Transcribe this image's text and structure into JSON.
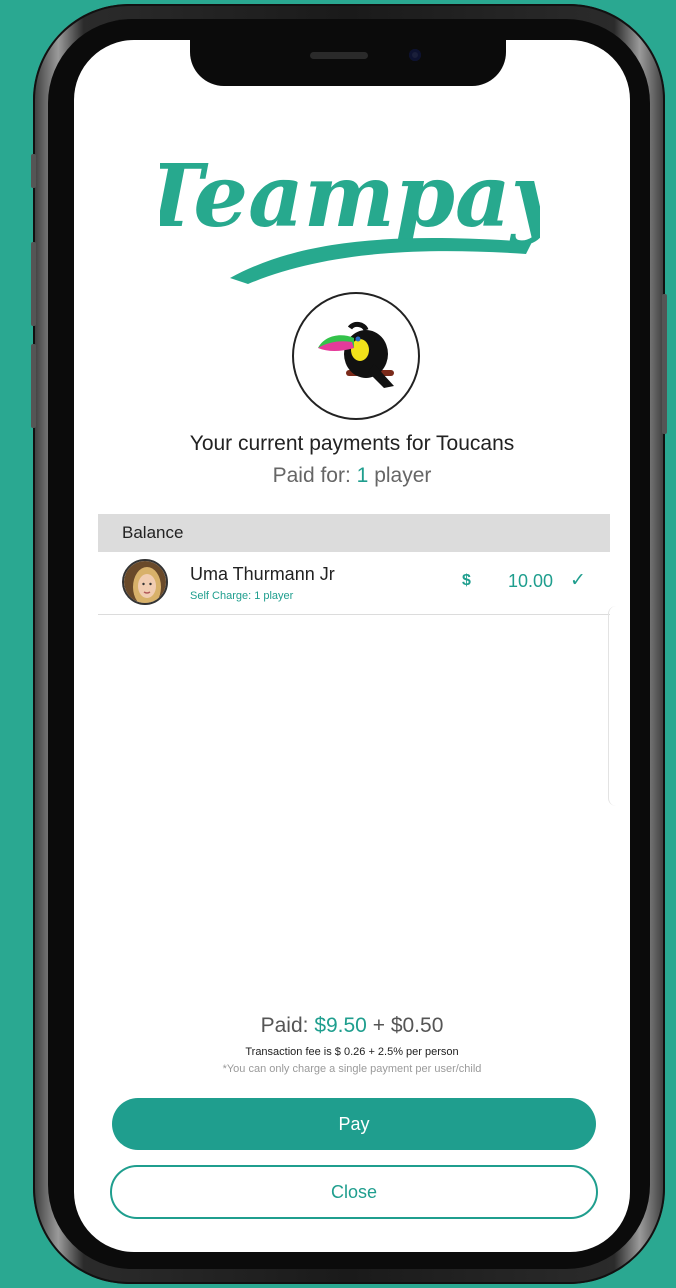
{
  "colors": {
    "background": "#2aa891",
    "accent": "#1f9e8e",
    "logo": "#27a98e"
  },
  "brand": {
    "logo_text": "Teampay"
  },
  "team": {
    "avatar_icon": "toucan-icon",
    "title": "Your current payments for Toucans",
    "paid_for_prefix": "Paid for:",
    "paid_for_count": "1",
    "paid_for_suffix": "player"
  },
  "balance": {
    "header": "Balance",
    "rows": [
      {
        "name": "Uma Thurmann Jr",
        "sub": "Self Charge: 1 player",
        "currency": "$",
        "amount": "10.00",
        "status_icon": "check-icon"
      }
    ]
  },
  "summary": {
    "paid_label": "Paid:",
    "paid_amount": "$9.50",
    "plus": "+",
    "fee_amount": "$0.50",
    "fee_note": "Transaction fee is $ 0.26 + 2.5% per person",
    "limit_note": "*You can only charge a single payment per user/child"
  },
  "actions": {
    "pay_label": "Pay",
    "close_label": "Close"
  }
}
